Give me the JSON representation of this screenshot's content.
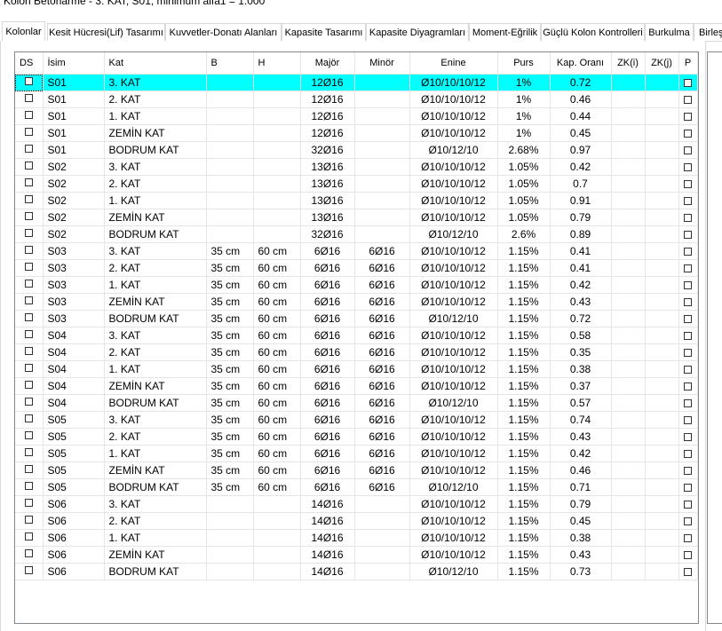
{
  "window": {
    "title": "Kolon Betonarme - 3. KAT, S01, minimum alfa1 = 1.000"
  },
  "tabs": [
    {
      "label": "Kolonlar",
      "active": true
    },
    {
      "label": "Kesit Hücresi(Lif) Tasarımı"
    },
    {
      "label": "Kuvvetler-Donatı Alanları"
    },
    {
      "label": "Kapasite Tasarımı"
    },
    {
      "label": "Kapasite Diyagramları"
    },
    {
      "label": "Moment-Eğrilik"
    },
    {
      "label": "Güçlü Kolon Kontrolleri"
    },
    {
      "label": "Burkulma"
    },
    {
      "label": "Birleş"
    }
  ],
  "table": {
    "headers": [
      "DS",
      "İsim",
      "Kat",
      "B",
      "H",
      "Majör",
      "Minör",
      "Enine",
      "Purs",
      "Kap. Oranı",
      "ZK(i)",
      "ZK(j)",
      "P"
    ],
    "selected_row": 0,
    "rows": [
      [
        "S01",
        "3. KAT",
        "",
        "",
        "12Ø16",
        "",
        "Ø10/10/10/12",
        "1%",
        "0.72"
      ],
      [
        "S01",
        "2. KAT",
        "",
        "",
        "12Ø16",
        "",
        "Ø10/10/10/12",
        "1%",
        "0.46"
      ],
      [
        "S01",
        "1. KAT",
        "",
        "",
        "12Ø16",
        "",
        "Ø10/10/10/12",
        "1%",
        "0.44"
      ],
      [
        "S01",
        "ZEMİN KAT",
        "",
        "",
        "12Ø16",
        "",
        "Ø10/10/10/12",
        "1%",
        "0.45"
      ],
      [
        "S01",
        "BODRUM KAT",
        "",
        "",
        "32Ø16",
        "",
        "Ø10/12/10",
        "2.68%",
        "0.97"
      ],
      [
        "S02",
        "3. KAT",
        "",
        "",
        "13Ø16",
        "",
        "Ø10/10/10/12",
        "1.05%",
        "0.42"
      ],
      [
        "S02",
        "2. KAT",
        "",
        "",
        "13Ø16",
        "",
        "Ø10/10/10/12",
        "1.05%",
        "0.7"
      ],
      [
        "S02",
        "1. KAT",
        "",
        "",
        "13Ø16",
        "",
        "Ø10/10/10/12",
        "1.05%",
        "0.91"
      ],
      [
        "S02",
        "ZEMİN KAT",
        "",
        "",
        "13Ø16",
        "",
        "Ø10/10/10/12",
        "1.05%",
        "0.79"
      ],
      [
        "S02",
        "BODRUM KAT",
        "",
        "",
        "32Ø16",
        "",
        "Ø10/12/10",
        "2.6%",
        "0.89"
      ],
      [
        "S03",
        "3. KAT",
        "35 cm",
        "60 cm",
        "6Ø16",
        "6Ø16",
        "Ø10/10/10/12",
        "1.15%",
        "0.41"
      ],
      [
        "S03",
        "2. KAT",
        "35 cm",
        "60 cm",
        "6Ø16",
        "6Ø16",
        "Ø10/10/10/12",
        "1.15%",
        "0.41"
      ],
      [
        "S03",
        "1. KAT",
        "35 cm",
        "60 cm",
        "6Ø16",
        "6Ø16",
        "Ø10/10/10/12",
        "1.15%",
        "0.42"
      ],
      [
        "S03",
        "ZEMİN KAT",
        "35 cm",
        "60 cm",
        "6Ø16",
        "6Ø16",
        "Ø10/10/10/12",
        "1.15%",
        "0.43"
      ],
      [
        "S03",
        "BODRUM KAT",
        "35 cm",
        "60 cm",
        "6Ø16",
        "6Ø16",
        "Ø10/12/10",
        "1.15%",
        "0.72"
      ],
      [
        "S04",
        "3. KAT",
        "35 cm",
        "60 cm",
        "6Ø16",
        "6Ø16",
        "Ø10/10/10/12",
        "1.15%",
        "0.58"
      ],
      [
        "S04",
        "2. KAT",
        "35 cm",
        "60 cm",
        "6Ø16",
        "6Ø16",
        "Ø10/10/10/12",
        "1.15%",
        "0.35"
      ],
      [
        "S04",
        "1. KAT",
        "35 cm",
        "60 cm",
        "6Ø16",
        "6Ø16",
        "Ø10/10/10/12",
        "1.15%",
        "0.38"
      ],
      [
        "S04",
        "ZEMİN KAT",
        "35 cm",
        "60 cm",
        "6Ø16",
        "6Ø16",
        "Ø10/10/10/12",
        "1.15%",
        "0.37"
      ],
      [
        "S04",
        "BODRUM KAT",
        "35 cm",
        "60 cm",
        "6Ø16",
        "6Ø16",
        "Ø10/12/10",
        "1.15%",
        "0.57"
      ],
      [
        "S05",
        "3. KAT",
        "35 cm",
        "60 cm",
        "6Ø16",
        "6Ø16",
        "Ø10/10/10/12",
        "1.15%",
        "0.74"
      ],
      [
        "S05",
        "2. KAT",
        "35 cm",
        "60 cm",
        "6Ø16",
        "6Ø16",
        "Ø10/10/10/12",
        "1.15%",
        "0.43"
      ],
      [
        "S05",
        "1. KAT",
        "35 cm",
        "60 cm",
        "6Ø16",
        "6Ø16",
        "Ø10/10/10/12",
        "1.15%",
        "0.42"
      ],
      [
        "S05",
        "ZEMİN KAT",
        "35 cm",
        "60 cm",
        "6Ø16",
        "6Ø16",
        "Ø10/10/10/12",
        "1.15%",
        "0.46"
      ],
      [
        "S05",
        "BODRUM KAT",
        "35 cm",
        "60 cm",
        "6Ø16",
        "6Ø16",
        "Ø10/12/10",
        "1.15%",
        "0.71"
      ],
      [
        "S06",
        "3. KAT",
        "",
        "",
        "14Ø16",
        "",
        "Ø10/10/10/12",
        "1.15%",
        "0.79"
      ],
      [
        "S06",
        "2. KAT",
        "",
        "",
        "14Ø16",
        "",
        "Ø10/10/10/12",
        "1.15%",
        "0.45"
      ],
      [
        "S06",
        "1. KAT",
        "",
        "",
        "14Ø16",
        "",
        "Ø10/10/10/12",
        "1.15%",
        "0.38"
      ],
      [
        "S06",
        "ZEMİN KAT",
        "",
        "",
        "14Ø16",
        "",
        "Ø10/10/10/12",
        "1.15%",
        "0.43"
      ],
      [
        "S06",
        "BODRUM KAT",
        "",
        "",
        "14Ø16",
        "",
        "Ø10/12/10",
        "1.15%",
        "0.73"
      ]
    ]
  },
  "colors": {
    "selection": "#00ffff",
    "grid_line": "#e5e5e5",
    "border": "#828790"
  }
}
